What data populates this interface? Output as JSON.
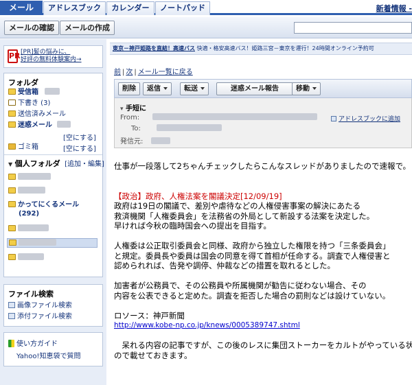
{
  "tabs": {
    "mail": "メール",
    "addressbook": "アドレスブック",
    "calendar": "カレンダー",
    "notepad": "ノートパッド"
  },
  "new_info": "新着情報 - ",
  "toolbar": {
    "check_mail": "メールの確認",
    "compose": "メールの作成"
  },
  "sidebar": {
    "promo_icon": "PR",
    "promo_line1": "[PR]髪の悩みに、",
    "promo_line2": "好評の無料体験案内→",
    "folders_title": "フォルダ",
    "inbox": "受信箱",
    "drafts": "下書き (3)",
    "sent": "送信済みメール",
    "spam": "迷惑メール",
    "spam_empty": "[空にする]",
    "trash": "ゴミ箱",
    "trash_empty": "[空にする]",
    "personal_title": "個人フォルダ",
    "personal_edit": "[追加・編集]",
    "kattekuru": "かってにくるメール",
    "kattekuru_count": "(292)",
    "filesearch_title": "ファイル検索",
    "image_search": "画像ファイル検索",
    "attach_search": "添付ファイル検索",
    "guide": "使い方ガイド",
    "chiebukuro": "Yahoo!知恵袋で質問"
  },
  "main": {
    "banner_bold": "東京－神戸姫路を直結！高速バス",
    "banner_rest": " 快適・格安高速バス！姫路三宮－東京を運行！24時間オンライン予約可",
    "nav_prev": "前",
    "nav_next": "次",
    "nav_back": "メール一覧に戻る",
    "btn_delete": "削除",
    "btn_reply": "返信",
    "btn_forward": "転送",
    "btn_spam_report": "迷惑メール報告",
    "btn_move": "移動",
    "subject": "手短に",
    "from_label": "From:",
    "to_label": "To:",
    "sender_label": "発信元:",
    "add_to_addressbook": "アドレスブックに追加",
    "body": {
      "line1": "仕事が一段落して2ちゃんチェックしたらこんなスレッドがありましたので速報で。",
      "headline": "【政治】政府、人権法案を閣議決定[12/09/19]",
      "p1_1": "政府は19日の閣議で、差別や虐待などの人権侵害事案の解決にあたる",
      "p1_2": "救済機関「人権委員会」を法務省の外局として新設する法案を決定した。",
      "p1_3": "早ければ今秋の臨時国会への提出を目指す。",
      "p2_1": "人権委は公正取引委員会と同様、政府から独立した権限を持つ「三条委員会」",
      "p2_2": "と規定。委員長や委員は国会の同意を得て首相が任命する。調査で人権侵害と",
      "p2_3": "認められれば、告発や調停、仲裁などの措置を取れるとした。",
      "p3_1": "加害者が公務員で、その公務員や所属機関が勧告に従わない場合、その",
      "p3_2": "内容を公表できると定めた。調査を拒否した場合の罰則などは設けていない。",
      "source": "ロソース：神戸新聞",
      "url": "http://www.kobe-np.co.jp/knews/0005389747.shtml",
      "last_1": "　呆れる内容の記事ですが、この後のレスに集団ストーカーをカルトがやっている状況",
      "last_2": "ので載せておきます。"
    }
  }
}
